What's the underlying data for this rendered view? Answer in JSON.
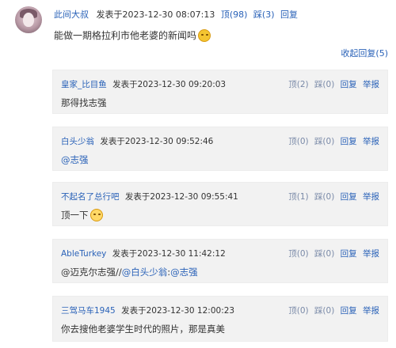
{
  "main": {
    "user": "此间大叔",
    "meta": "发表于2023-12-30 08:07:13",
    "up": "顶(98)",
    "down": "踩(3)",
    "reply": "回复",
    "content": "能做一期格拉利市他老婆的新闻吗",
    "emoji": "smile-emoji"
  },
  "collapse": "收起回复(5)",
  "replies": [
    {
      "user": "皇家_比目鱼",
      "meta": "发表于2023-12-30 09:20:03",
      "up": "顶(2)",
      "down": "踩(0)",
      "reply": "回复",
      "report": "举报",
      "content": "那得找志强"
    },
    {
      "user": "白头少翁",
      "meta": "发表于2023-12-30 09:52:46",
      "up": "顶(0)",
      "down": "踩(0)",
      "reply": "回复",
      "report": "举报",
      "mention": "@志强"
    },
    {
      "user": "不起名了总行吧",
      "meta": "发表于2023-12-30 09:55:41",
      "up": "顶(1)",
      "down": "踩(0)",
      "reply": "回复",
      "report": "举报",
      "content": "顶一下",
      "emoji": "shy-emoji"
    },
    {
      "user": "AbleTurkey",
      "meta": "发表于2023-12-30 11:42:12",
      "up": "顶(0)",
      "down": "踩(0)",
      "reply": "回复",
      "report": "举报",
      "content": "@迈克尔志强//",
      "mention1": "@白头少翁",
      "mid": ": ",
      "mention2": "@志强"
    },
    {
      "user": "三驾马车1945",
      "meta": "发表于2023-12-30 12:00:23",
      "up": "顶(0)",
      "down": "踩(0)",
      "reply": "回复",
      "report": "举报",
      "content": "你去搜他老婆学生时代的照片，那是真美"
    }
  ]
}
